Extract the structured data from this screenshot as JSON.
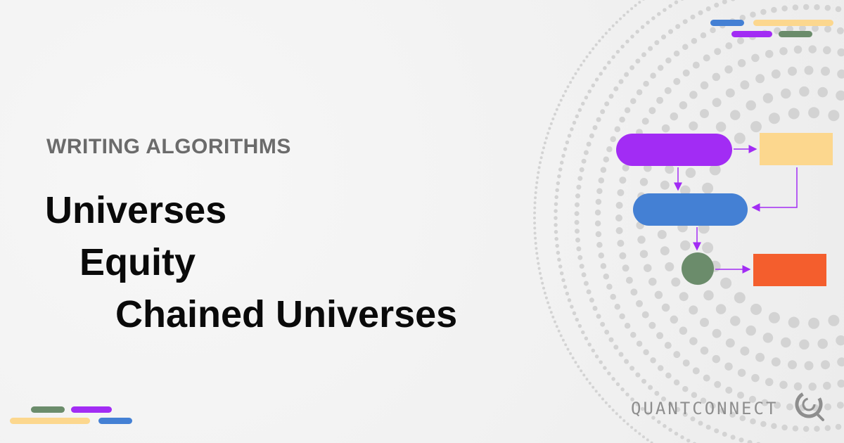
{
  "header": {
    "eyebrow": "WRITING ALGORITHMS"
  },
  "breadcrumb": {
    "level1": "Universes",
    "level2": "Equity",
    "level3": "Chained Universes"
  },
  "brand": {
    "name": "QUANTCONNECT",
    "logo_icon": "quantconnect-logo-icon"
  },
  "colors": {
    "purple": "#a22cf4",
    "blue": "#4480d4",
    "yellow": "#fcd78e",
    "green": "#6b8c6b",
    "orange": "#f45e2d",
    "dots": "#d3d3d3",
    "arrow": "#a22cf4"
  },
  "decor": {
    "top_right_bars": [
      "blue",
      "yellow",
      "purple",
      "green"
    ],
    "bottom_left_bars": [
      "green",
      "purple",
      "yellow",
      "blue"
    ]
  },
  "diagram": {
    "nodes": [
      "purple-pill",
      "yellow-rect",
      "blue-pill",
      "green-circle",
      "orange-rect"
    ],
    "edges": [
      [
        "purple-pill",
        "yellow-rect"
      ],
      [
        "purple-pill",
        "blue-pill"
      ],
      [
        "yellow-rect",
        "blue-pill"
      ],
      [
        "blue-pill",
        "green-circle"
      ],
      [
        "green-circle",
        "orange-rect"
      ]
    ]
  }
}
